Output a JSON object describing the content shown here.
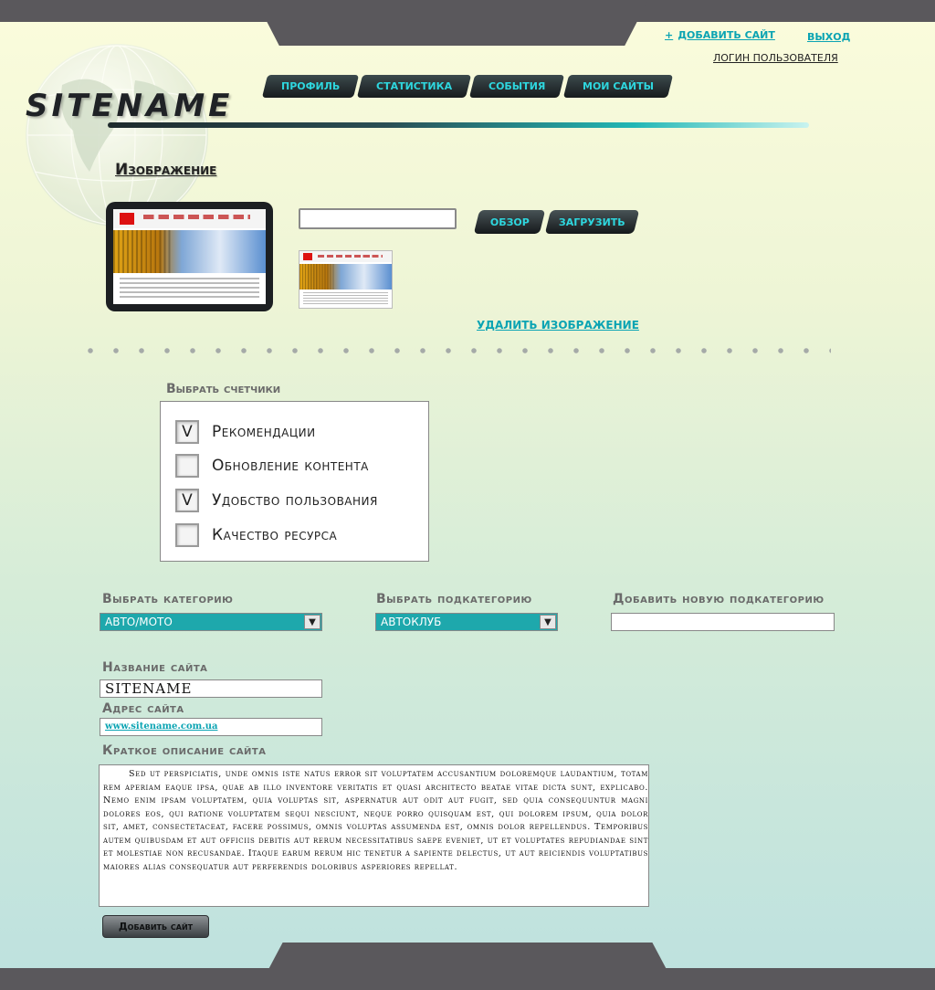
{
  "header": {
    "logo": "SITENAME",
    "add_site_plus": "+",
    "add_site_label": "добавить сайт",
    "exit_label": "выход",
    "login_label": "логин пользователя"
  },
  "nav": {
    "tabs": [
      "профиль",
      "статистика",
      "события",
      "мои сайты"
    ]
  },
  "image_section": {
    "title": "Изображение",
    "browse_label": "обзор",
    "upload_label": "загрузить",
    "delete_label": "удалить изображение"
  },
  "counters": {
    "label": "Выбрать счетчики",
    "items": [
      {
        "label": "Рекомендации",
        "mark": "V"
      },
      {
        "label": "Обновление контента",
        "mark": ""
      },
      {
        "label": "Удобство пользования",
        "mark": "V"
      },
      {
        "label": "Качество ресурса",
        "mark": ""
      }
    ]
  },
  "category": {
    "label": "Выбрать категорию",
    "value": "авто/мото"
  },
  "subcategory": {
    "label": "Выбрать подкатегорию",
    "value": "автоклуб"
  },
  "new_subcategory": {
    "label": "Добавить новую подкатегорию",
    "value": ""
  },
  "site_name": {
    "label": "Название сайта",
    "value": "SITENAME"
  },
  "site_address": {
    "label": "Адрес сайта",
    "value": "www.sitename.com.ua"
  },
  "description": {
    "label": "Краткое описание сайта",
    "value": "Sed ut perspiciatis, unde omnis iste natus error sit voluptatem accusantium doloremque laudantium, totam rem aperiam eaque ipsa, quae ab illo inventore veritatis et quasi architecto beatae vitae dicta sunt, explicabo. Nemo enim ipsam voluptatem, quia voluptas sit, aspernatur aut odit aut fugit, sed quia consequuntur magni dolores eos, qui ratione voluptatem sequi nesciunt, neque porro quisquam est, qui dolorem ipsum, quia dolor sit, amet, consectetaceat, facere possimus, omnis voluptas assumenda est, omnis dolor repellendus. Temporibus autem quibusdam et aut officiis debitis aut rerum necessitatibus saepe eveniet, ut et voluptates repudiandae sint et molestiae non recusandae. Itaque earum rerum hic tenetur a sapiente delectus, ut aut reiciendis voluptatibus maiores alias consequatur aut perferendis doloribus asperiores repellat."
  },
  "submit": {
    "label": "Добавить сайт"
  },
  "colors": {
    "accent": "#0ba4b3",
    "bar": "#5a585c",
    "select_bg": "#1ea8ac"
  }
}
